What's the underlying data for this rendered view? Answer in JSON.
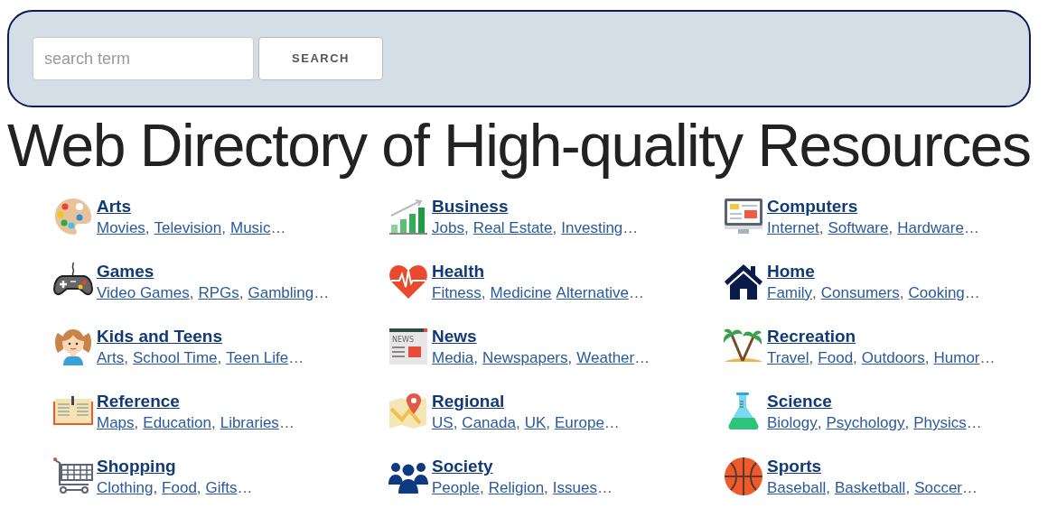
{
  "search": {
    "placeholder": "search term",
    "button": "SEARCH"
  },
  "heading": "Web Directory of High-quality Resources",
  "categories": [
    {
      "kind": "palette",
      "title": "Arts",
      "links": [
        {
          "label": "Movies",
          "after": ","
        },
        {
          "label": "Television",
          "after": ","
        },
        {
          "label": "Music",
          "after": "…"
        }
      ]
    },
    {
      "kind": "chart",
      "title": "Business",
      "links": [
        {
          "label": "Jobs",
          "after": ","
        },
        {
          "label": "Real Estate",
          "after": ","
        },
        {
          "label": "Investing",
          "after": "…"
        }
      ]
    },
    {
      "kind": "monitor",
      "title": "Computers",
      "links": [
        {
          "label": "Internet",
          "after": ","
        },
        {
          "label": "Software",
          "after": ","
        },
        {
          "label": "Hardware",
          "after": "…"
        }
      ]
    },
    {
      "kind": "gamepad",
      "title": "Games",
      "links": [
        {
          "label": "Video Games",
          "after": ","
        },
        {
          "label": "RPGs",
          "after": ","
        },
        {
          "label": "Gambling",
          "after": "…"
        }
      ]
    },
    {
      "kind": "heart",
      "title": "Health",
      "links": [
        {
          "label": "Fitness",
          "after": ","
        },
        {
          "label": "Medicine"
        },
        {
          "label": "Alternative",
          "after": "…"
        }
      ]
    },
    {
      "kind": "house",
      "title": "Home",
      "links": [
        {
          "label": "Family",
          "after": ","
        },
        {
          "label": "Consumers",
          "after": ","
        },
        {
          "label": "Cooking",
          "after": "…"
        }
      ]
    },
    {
      "kind": "girl",
      "title": "Kids and Teens",
      "links": [
        {
          "label": "Arts",
          "after": ","
        },
        {
          "label": "School Time",
          "after": ","
        },
        {
          "label": "Teen Life",
          "after": "…"
        }
      ]
    },
    {
      "kind": "news",
      "icon_text": "NEWS",
      "title": "News",
      "links": [
        {
          "label": "Media",
          "after": ","
        },
        {
          "label": "Newspapers",
          "after": ","
        },
        {
          "label": "Weather",
          "after": "…"
        }
      ]
    },
    {
      "kind": "palm",
      "title": "Recreation",
      "links": [
        {
          "label": "Travel",
          "after": ","
        },
        {
          "label": "Food",
          "after": ","
        },
        {
          "label": "Outdoors",
          "after": ","
        },
        {
          "label": "Humor",
          "after": "…"
        }
      ]
    },
    {
      "kind": "book",
      "title": "Reference",
      "links": [
        {
          "label": "Maps",
          "after": ","
        },
        {
          "label": "Education",
          "after": ","
        },
        {
          "label": "Libraries",
          "after": "…"
        }
      ]
    },
    {
      "kind": "map",
      "title": "Regional",
      "links": [
        {
          "label": "US",
          "after": ","
        },
        {
          "label": "Canada",
          "after": ","
        },
        {
          "label": "UK",
          "after": ","
        },
        {
          "label": "Europe",
          "after": "…"
        }
      ]
    },
    {
      "kind": "flask",
      "title": "Science",
      "links": [
        {
          "label": "Biology",
          "after": ","
        },
        {
          "label": "Psychology",
          "after": ","
        },
        {
          "label": "Physics",
          "after": "…"
        }
      ]
    },
    {
      "kind": "cart",
      "title": "Shopping",
      "links": [
        {
          "label": "Clothing",
          "after": ","
        },
        {
          "label": "Food",
          "after": ","
        },
        {
          "label": "Gifts",
          "after": "…"
        }
      ]
    },
    {
      "kind": "people",
      "title": "Society",
      "links": [
        {
          "label": "People",
          "after": ","
        },
        {
          "label": "Religion",
          "after": ","
        },
        {
          "label": "Issues",
          "after": "…"
        }
      ]
    },
    {
      "kind": "ball",
      "title": "Sports",
      "links": [
        {
          "label": "Baseball",
          "after": ","
        },
        {
          "label": "Basketball",
          "after": ","
        },
        {
          "label": "Soccer",
          "after": "…"
        }
      ]
    }
  ]
}
